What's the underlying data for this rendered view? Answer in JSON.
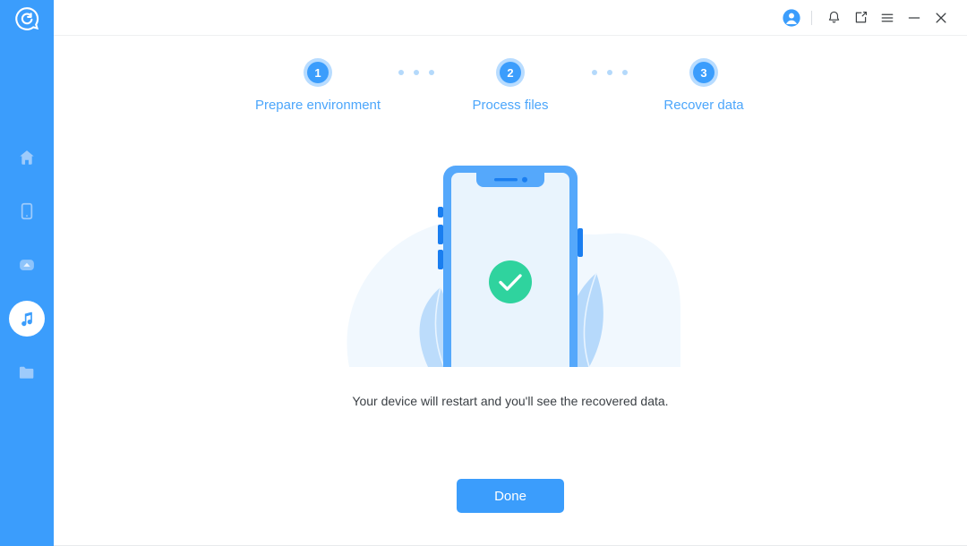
{
  "app": {
    "logo_icon": "app-logo-icon",
    "accent_color": "#3b9dfc",
    "sidebar_color": "#3b9dfc",
    "success_color": "#2fd39e"
  },
  "titlebar": {
    "items": [
      {
        "name": "account-avatar",
        "icon": "user-avatar-icon"
      },
      {
        "name": "notifications",
        "icon": "bell-icon"
      },
      {
        "name": "feedback",
        "icon": "note-edit-icon"
      },
      {
        "name": "menu",
        "icon": "hamburger-menu-icon"
      },
      {
        "name": "minimize",
        "icon": "minimize-icon"
      },
      {
        "name": "close",
        "icon": "close-icon"
      }
    ]
  },
  "sidebar": {
    "items": [
      {
        "name": "home",
        "icon": "home-icon",
        "active": false
      },
      {
        "name": "device",
        "icon": "phone-icon",
        "active": false
      },
      {
        "name": "cloud",
        "icon": "cloud-icon",
        "active": false
      },
      {
        "name": "music",
        "icon": "music-note-icon",
        "active": true
      },
      {
        "name": "files",
        "icon": "folder-icon",
        "active": false
      }
    ]
  },
  "stepper": {
    "steps": [
      {
        "number": "1",
        "label": "Prepare environment"
      },
      {
        "number": "2",
        "label": "Process files"
      },
      {
        "number": "3",
        "label": "Recover data"
      }
    ],
    "separator_dot_count": 3
  },
  "illustration": {
    "name": "phone-success-illustration",
    "status_icon": "check-circle-icon"
  },
  "main": {
    "message": "Your device will restart and you'll see the recovered data.",
    "done_label": "Done"
  }
}
